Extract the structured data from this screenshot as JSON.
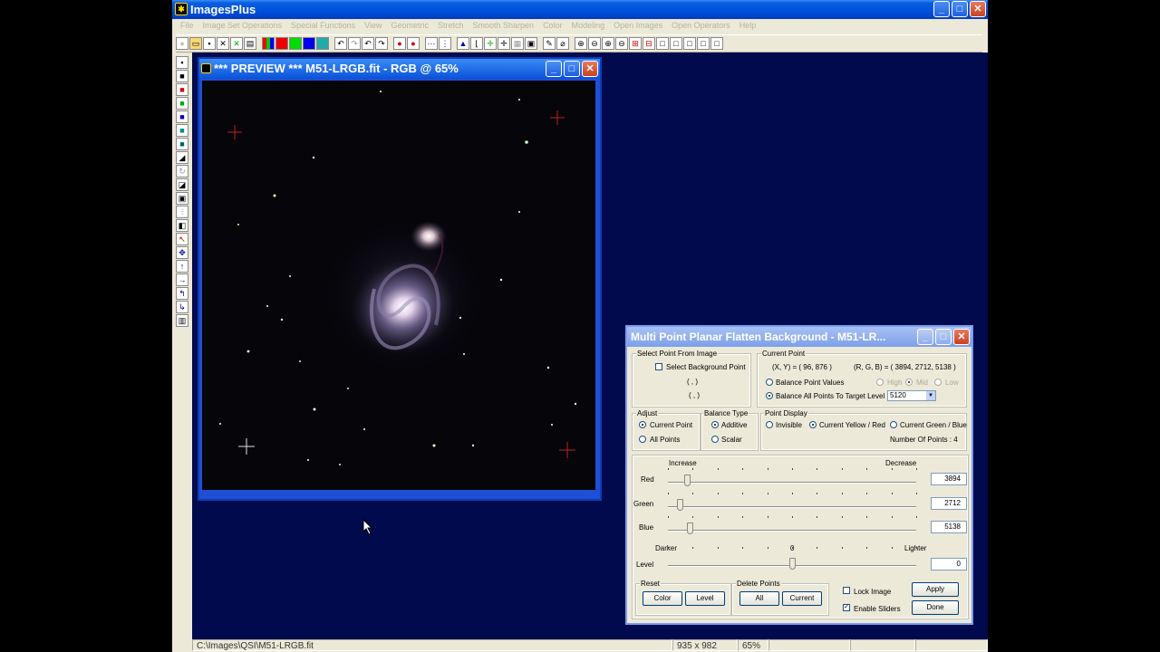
{
  "app": {
    "title": "ImagesPlus",
    "window_buttons": [
      "_",
      "□",
      "✕"
    ]
  },
  "menu": [
    "File",
    "Image Set Operations",
    "Special Functions",
    "View",
    "Geometric",
    "Stretch",
    "Smooth Sharpen",
    "Color",
    "Modeling",
    "Open Images",
    "Open Operators",
    "Help"
  ],
  "preview": {
    "title": "*** PREVIEW *** M51-LRGB.fit - RGB @ 65%"
  },
  "dialog": {
    "title": "Multi Point Planar Flatten Background - M51-LR...",
    "select_point": {
      "label": "Select Point From Image",
      "checkbox": "Select Background Point",
      "line1": "( , )",
      "line2": "( , )"
    },
    "current_point": {
      "label": "Current Point",
      "xy": "(X, Y) = ( 96, 876 )",
      "rgb": "(R, G, B) = ( 3894, 2712, 5138 )",
      "high": "High",
      "mid": "Mid",
      "low": "Low",
      "balance_values": "Balance Point Values",
      "balance_all": "Balance All Points To Target Level",
      "target_level": "5120"
    },
    "adjust": {
      "label": "Adjust",
      "current": "Current Point",
      "all": "All Points"
    },
    "balance_type": {
      "label": "Balance Type",
      "additive": "Additive",
      "scalar": "Scalar"
    },
    "point_display": {
      "label": "Point Display",
      "invisible": "Invisible",
      "yellow_red": "Current Yellow / Red",
      "green_blue": "Current Green / Blue",
      "count": "Number Of Points : 4"
    },
    "sliders": {
      "increase": "Increase",
      "decrease": "Decrease",
      "red_label": "Red",
      "red_value": "3894",
      "red_position": 0.08,
      "green_label": "Green",
      "green_value": "2712",
      "green_position": 0.05,
      "blue_label": "Blue",
      "blue_value": "5138",
      "blue_position": 0.09,
      "darker": "Darker",
      "zero": "0",
      "lighter": "Lighter",
      "level_label": "Level",
      "level_value": "0",
      "level_position": 0.5
    },
    "reset": {
      "label": "Reset",
      "color": "Color",
      "level": "Level"
    },
    "delete_points": {
      "label": "Delete Points",
      "all": "All",
      "current": "Current"
    },
    "lock_image": "Lock Image",
    "enable_sliders": "Enable Sliders",
    "apply": "Apply",
    "done": "Done"
  },
  "status": {
    "path": "C:\\Images\\QSI\\M51-LRGB.fit",
    "size": "935 x 982",
    "zoom": "65%"
  }
}
